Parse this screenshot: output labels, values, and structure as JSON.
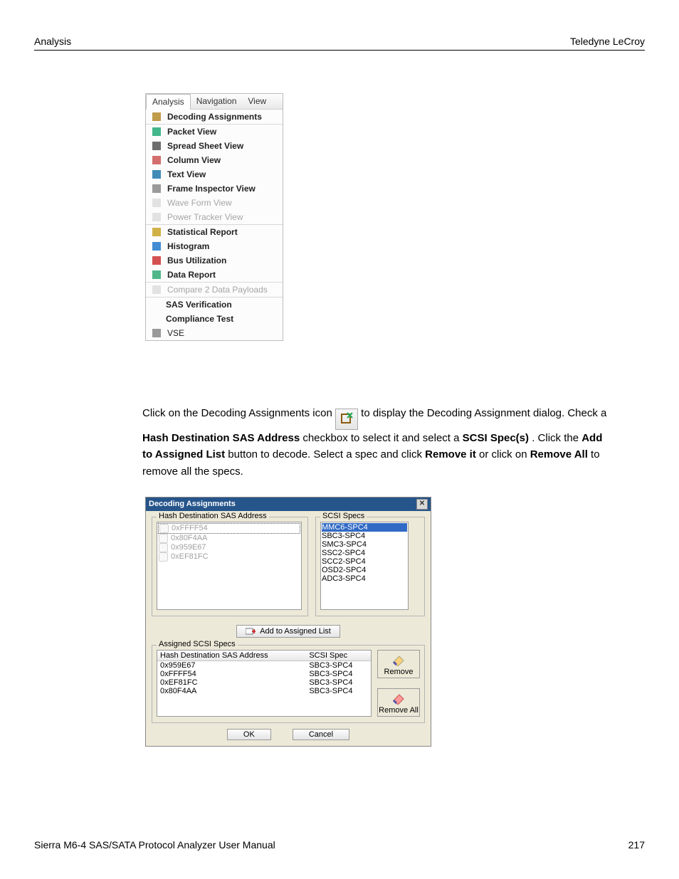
{
  "header": {
    "left": "Analysis",
    "right": "Teledyne LeCroy"
  },
  "footer": {
    "left": "Sierra M6-4 SAS/SATA Protocol Analyzer User Manual",
    "right": "217"
  },
  "menu": {
    "tabs": [
      "Analysis",
      "Navigation",
      "View"
    ],
    "items": [
      {
        "label": "Decoding Assignments",
        "bold": true
      },
      {
        "sep": true
      },
      {
        "label": "Packet View",
        "bold": true
      },
      {
        "label": "Spread Sheet View",
        "bold": true
      },
      {
        "label": "Column View",
        "bold": true
      },
      {
        "label": "Text View",
        "bold": true
      },
      {
        "label": "Frame Inspector View",
        "bold": true
      },
      {
        "label": "Wave Form View",
        "disabled": true
      },
      {
        "label": "Power Tracker View",
        "disabled": true
      },
      {
        "sep": true
      },
      {
        "label": "Statistical Report",
        "bold": true
      },
      {
        "label": "Histogram",
        "bold": true
      },
      {
        "label": "Bus Utilization",
        "bold": true
      },
      {
        "label": "Data Report",
        "bold": true
      },
      {
        "sep": true
      },
      {
        "label": "Compare 2 Data Payloads",
        "disabled": true
      },
      {
        "sep": true
      },
      {
        "label": "SAS Verification",
        "bold": true,
        "noicon": true
      },
      {
        "label": "Compliance Test",
        "bold": true,
        "noicon": true
      },
      {
        "label": "VSE"
      }
    ]
  },
  "paragraph": {
    "p1a": "Click on the Decoding Assignments icon ",
    "p1b": " to display the Decoding Assignment dialog. Check a ",
    "b1": "Hash Destination SAS Address",
    "p2": " checkbox to select it and select a ",
    "b2": "SCSI Spec(s)",
    "p3": ". Click the ",
    "b3": "Add to Assigned List",
    "p4": " button to decode. Select a spec and click ",
    "b4": "Remove it",
    "p5": " or click on ",
    "b5": "Remove All",
    "p6": " to remove all the specs."
  },
  "dialog": {
    "title": "Decoding Assignments",
    "hash_legend": "Hash Destination SAS Address",
    "scsi_legend": "SCSI Specs",
    "hash_items": [
      "0xFFFF54",
      "0x80F4AA",
      "0x959E67",
      "0xEF81FC"
    ],
    "scsi_items": [
      "MMC6-SPC4",
      "SBC3-SPC4",
      "SMC3-SPC4",
      "SSC2-SPC4",
      "SCC2-SPC4",
      "OSD2-SPC4",
      "ADC3-SPC4"
    ],
    "add_label": "Add  to Assigned List",
    "assigned_legend": "Assigned SCSI Specs",
    "col1": "Hash Destination SAS Address",
    "col2": "SCSI Spec",
    "assigned_rows": [
      {
        "addr": "0x959E67",
        "spec": "SBC3-SPC4"
      },
      {
        "addr": "0xFFFF54",
        "spec": "SBC3-SPC4"
      },
      {
        "addr": "0xEF81FC",
        "spec": "SBC3-SPC4"
      },
      {
        "addr": "0x80F4AA",
        "spec": "SBC3-SPC4"
      }
    ],
    "remove_label": "Remove",
    "remove_all_label": "Remove All",
    "ok": "OK",
    "cancel": "Cancel"
  }
}
